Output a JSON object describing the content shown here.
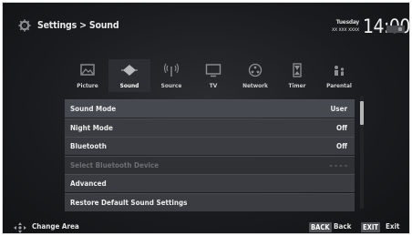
{
  "header": {
    "breadcrumb": "Settings > Sound",
    "weekday": "Tuesday",
    "date": "xx xxx xxxx",
    "time": "14:00"
  },
  "tabs": [
    {
      "label": "Picture",
      "icon": "picture-icon",
      "active": false
    },
    {
      "label": "Sound",
      "icon": "sound-icon",
      "active": true
    },
    {
      "label": "Source",
      "icon": "source-icon",
      "active": false
    },
    {
      "label": "TV",
      "icon": "tv-icon",
      "active": false
    },
    {
      "label": "Network",
      "icon": "network-icon",
      "active": false
    },
    {
      "label": "Timer",
      "icon": "timer-icon",
      "active": false
    },
    {
      "label": "Parental",
      "icon": "parental-icon",
      "active": false
    }
  ],
  "menu": [
    {
      "label": "Sound Mode",
      "value": "User"
    },
    {
      "label": "Night Mode",
      "value": "Off"
    },
    {
      "label": "Bluetooth",
      "value": "Off"
    },
    {
      "label": "Select Bluetooth Device",
      "value": "- - - -",
      "disabled": true
    },
    {
      "label": "Advanced",
      "value": ""
    },
    {
      "label": "Restore Default Sound Settings",
      "value": ""
    }
  ],
  "footer": {
    "change_area": "Change Area",
    "back_key": "BACK",
    "back_label": "Back",
    "exit_key": "EXIT",
    "exit_label": "Exit"
  },
  "colors": {
    "background": "#1a1b1e",
    "row": "#3a3c41",
    "accent": "#b5b5b5"
  }
}
